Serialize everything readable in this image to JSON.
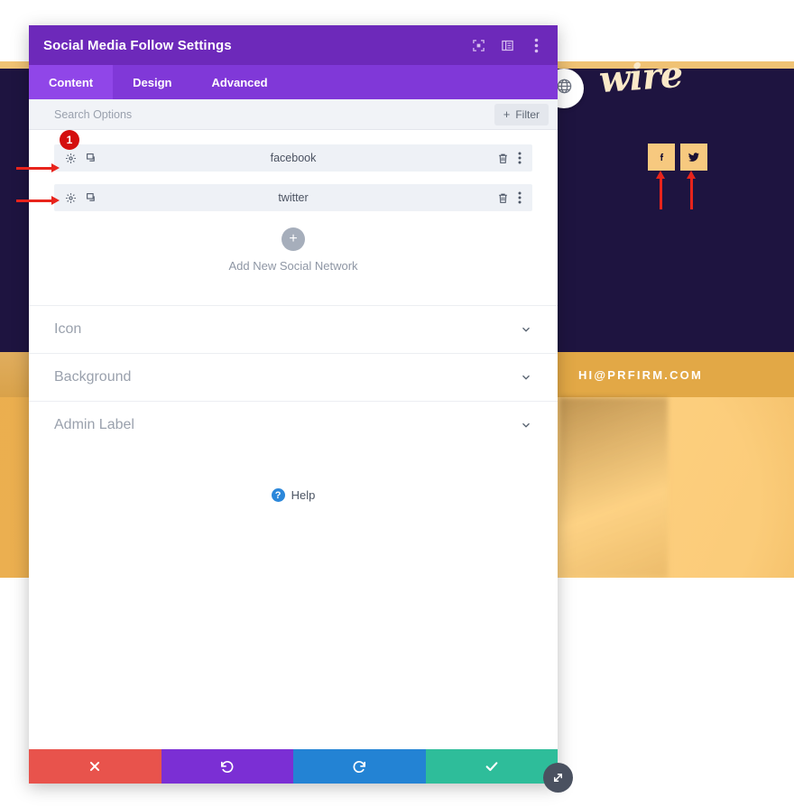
{
  "background": {
    "logo_text": "wire",
    "contact_bar_text": "HI@PRFIRM.COM",
    "social_buttons": [
      {
        "name": "facebook",
        "glyph": "facebook-icon"
      },
      {
        "name": "twitter",
        "glyph": "twitter-icon"
      }
    ],
    "globe_icon": "globe-icon"
  },
  "modal": {
    "title": "Social Media Follow Settings",
    "header_icons": [
      {
        "name": "expand-icon"
      },
      {
        "name": "layout-columns-icon"
      },
      {
        "name": "more-vertical-icon"
      }
    ],
    "tabs": [
      {
        "label": "Content",
        "active": true
      },
      {
        "label": "Design",
        "active": false
      },
      {
        "label": "Advanced",
        "active": false
      }
    ],
    "search": {
      "value": "",
      "placeholder": "Search Options"
    },
    "filter_label": "Filter",
    "filter_plus": "+",
    "badge": "1",
    "rows": [
      {
        "title": "facebook",
        "gear_icon": "gear-icon",
        "duplicate_icon": "duplicate-icon",
        "delete_icon": "trash-icon",
        "more_icon": "more-vertical-icon"
      },
      {
        "title": "twitter",
        "gear_icon": "gear-icon",
        "duplicate_icon": "duplicate-icon",
        "delete_icon": "trash-icon",
        "more_icon": "more-vertical-icon"
      }
    ],
    "add_new": {
      "plus": "+",
      "label": "Add New Social Network"
    },
    "accordions": [
      {
        "label": "Icon",
        "chevron": "chevron-down-icon"
      },
      {
        "label": "Background",
        "chevron": "chevron-down-icon"
      },
      {
        "label": "Admin Label",
        "chevron": "chevron-down-icon"
      }
    ],
    "help": {
      "badge": "?",
      "label": "Help"
    },
    "footer_buttons": [
      {
        "name": "cancel-button",
        "icon": "close-icon",
        "color": "#e8534c"
      },
      {
        "name": "undo-button",
        "icon": "undo-icon",
        "color": "#7b2fd4"
      },
      {
        "name": "redo-button",
        "icon": "redo-icon",
        "color": "#2383d4"
      },
      {
        "name": "save-button",
        "icon": "check-icon",
        "color": "#2ebd9a"
      }
    ],
    "resize_icon": "resize-handle-icon"
  },
  "colors": {
    "header_purple": "#6d29ba",
    "tabbar_purple": "#8038d8",
    "tab_active_purple": "#9046e8",
    "badge_red": "#d40f0f",
    "annotation_red": "#e8241c",
    "hero_navy": "#1e1440",
    "accent_gold": "#f7c97f",
    "contact_gold": "#e2a846"
  }
}
